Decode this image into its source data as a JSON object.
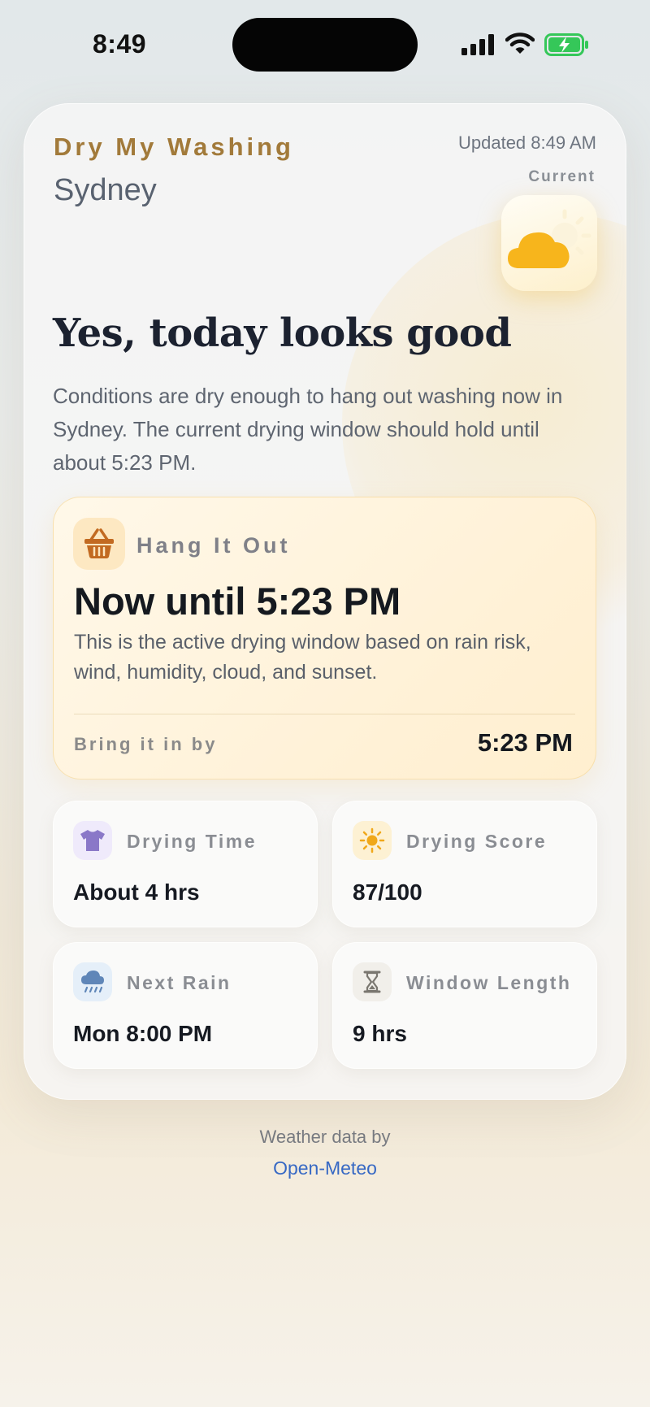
{
  "status_bar": {
    "time": "8:49"
  },
  "app": {
    "title": "Dry My Washing",
    "city": "Sydney",
    "updated": "Updated 8:49 AM",
    "current_label": "Current",
    "weather_icon": "partly-cloudy-icon"
  },
  "verdict": {
    "headline": "Yes, today looks good",
    "description": "Conditions are dry enough to hang out washing now in Sydney. The current drying window should hold until about 5:23 PM."
  },
  "hang_card": {
    "label": "Hang It Out",
    "window": "Now until 5:23 PM",
    "description": "This is the active drying window based on rain risk, wind, humidity, cloud, and sunset.",
    "bring_in_label": "Bring it in by",
    "bring_in_time": "5:23 PM"
  },
  "stats": [
    {
      "label": "Drying Time",
      "value": "About 4 hrs",
      "icon": "tshirt-icon",
      "icon_bg": "#efeafb"
    },
    {
      "label": "Drying Score",
      "value": "87/100",
      "icon": "sun-icon",
      "icon_bg": "#fdf1d3"
    },
    {
      "label": "Next Rain",
      "value": "Mon 8:00 PM",
      "icon": "rain-cloud-icon",
      "icon_bg": "#e5eff9"
    },
    {
      "label": "Window Length",
      "value": "9 hrs",
      "icon": "hourglass-icon",
      "icon_bg": "#f1efea"
    }
  ],
  "footer": {
    "text": "Weather data by",
    "link": "Open-Meteo"
  },
  "colors": {
    "accent": "#a27a3a",
    "link": "#3769c4",
    "sun": "#f7b51c",
    "battery": "#35c759"
  }
}
